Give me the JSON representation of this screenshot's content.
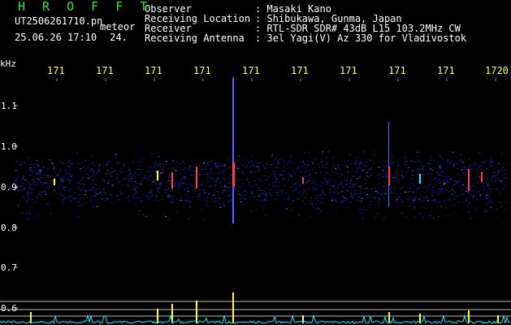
{
  "header": {
    "system_name": "H R O F F T",
    "file_name": "UT2506261710.pn",
    "detection_label": "meteor",
    "date_time": "25.06.26 17:10",
    "count": "24."
  },
  "station_info": [
    {
      "key": "Observer",
      "value": ": Masaki Kano"
    },
    {
      "key": "Receiving Location",
      "value": ": Shibukawa, Gunma, Japan"
    },
    {
      "key": "Receiver",
      "value": ": RTL-SDR SDR# 43dB L15 103.2MHz CW"
    },
    {
      "key": "Receiving Antenna",
      "value": ": 3el Yagi(V) Az 330 for Vladivostok"
    }
  ],
  "axes": {
    "y_unit": "kHz",
    "time_ticks": [
      "171",
      "171",
      "171",
      "171",
      "171",
      "171",
      "171",
      "171",
      "171",
      "1720"
    ],
    "freq_ticks": [
      "1.1",
      "1.0",
      "0.9",
      "0.8",
      "0.7",
      "0.6"
    ]
  },
  "colors": {
    "title_green": "#35e23a",
    "tick_yellow": "#ffff55",
    "noise_blue": "#1a22c8",
    "signal_red": "#ff3b5b",
    "signal_yellow": "#ffff33",
    "baseline_cyan": "#22e8ff"
  }
}
